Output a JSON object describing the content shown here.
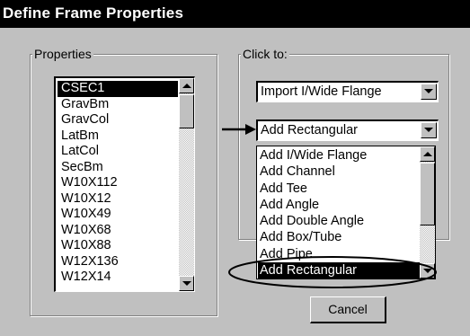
{
  "window": {
    "title": "Define Frame Properties"
  },
  "properties": {
    "group_label": "Properties",
    "items": [
      "CSEC1",
      "GravBm",
      "GravCol",
      "LatBm",
      "LatCol",
      "SecBm",
      "W10X112",
      "W10X12",
      "W10X49",
      "W10X68",
      "W10X88",
      "W12X136",
      "W12X14"
    ],
    "selected_index": 0
  },
  "click_to": {
    "group_label": "Click to:",
    "import_combo_value": "Import I/Wide Flange",
    "add_combo_value": "Add Rectangular",
    "dropdown_items": [
      "Add I/Wide Flange",
      "Add Channel",
      "Add Tee",
      "Add Angle",
      "Add Double Angle",
      "Add Box/Tube",
      "Add Pipe",
      "Add Rectangular"
    ],
    "dropdown_highlighted_index": 7
  },
  "buttons": {
    "cancel": "Cancel"
  },
  "annotation": {
    "arrow": "→",
    "ellipse_colour": "#000000"
  }
}
